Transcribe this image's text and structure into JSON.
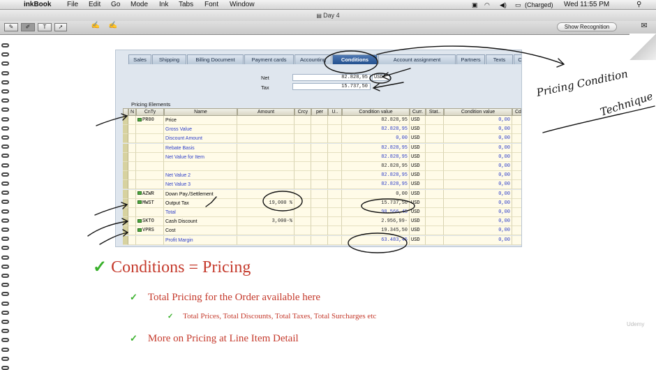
{
  "menubar": {
    "app": "inkBook",
    "items": [
      "File",
      "Edit",
      "Go",
      "Mode",
      "Ink",
      "Tabs",
      "Font",
      "Window"
    ],
    "battery": "(Charged)",
    "clock": "Wed 11:55 PM"
  },
  "window": {
    "title": "Day 4"
  },
  "toolbar": {
    "show_recognition": "Show Recognition"
  },
  "sap": {
    "tabs": [
      "Sales",
      "Shipping",
      "Billing Document",
      "Payment cards",
      "Accounting",
      "Conditions",
      "Account assignment",
      "Partners",
      "Texts",
      "Order"
    ],
    "active_tab": "Conditions",
    "net_label": "Net",
    "net_value": "82.828,95",
    "net_currency": "USD",
    "tax_label": "Tax",
    "tax_value": "15.737,50",
    "pricing_elements_title": "Pricing Elements",
    "columns": [
      "N",
      "CnTy",
      "Name",
      "Amount",
      "Crcy",
      "per",
      "U..",
      "Condition value",
      "Curr.",
      "Stat..",
      "Condition value",
      "CdC"
    ],
    "rows": [
      {
        "cnty": "PR00",
        "name": "Price",
        "amount": "",
        "cond": "82.828,95",
        "curr": "USD",
        "cv2": "0,00",
        "blue": false,
        "icon": true
      },
      {
        "cnty": "",
        "name": "Gross Value",
        "amount": "",
        "cond": "82.828,95",
        "curr": "USD",
        "cv2": "0,00",
        "blue": true,
        "icon": false
      },
      {
        "cnty": "",
        "name": "Discount Amount",
        "amount": "",
        "cond": "0,00",
        "curr": "USD",
        "cv2": "0,00",
        "blue": true,
        "icon": false
      },
      {
        "cnty": "",
        "name": "Rebate Basis",
        "amount": "",
        "cond": "82.828,95",
        "curr": "USD",
        "cv2": "0,00",
        "blue": true,
        "icon": false
      },
      {
        "cnty": "",
        "name": "Net Value for Item",
        "amount": "",
        "cond": "82.828,95",
        "curr": "USD",
        "cv2": "0,00",
        "blue": true,
        "icon": false
      },
      {
        "cnty": "",
        "name": "",
        "amount": "",
        "cond": "82.828,95",
        "curr": "USD",
        "cv2": "0,00",
        "blue": false,
        "icon": false
      },
      {
        "cnty": "",
        "name": "Net Value 2",
        "amount": "",
        "cond": "82.828,95",
        "curr": "USD",
        "cv2": "0,00",
        "blue": true,
        "icon": false
      },
      {
        "cnty": "",
        "name": "Net Value 3",
        "amount": "",
        "cond": "82.828,95",
        "curr": "USD",
        "cv2": "0,00",
        "blue": true,
        "icon": false
      },
      {
        "cnty": "AZWR",
        "name": "Down Pay./Settlement",
        "amount": "",
        "cond": "0,00",
        "curr": "USD",
        "cv2": "0,00",
        "blue": false,
        "icon": true
      },
      {
        "cnty": "MWST",
        "name": "Output Tax",
        "amount": "19,000 %",
        "cond": "15.737,50",
        "curr": "USD",
        "cv2": "0,00",
        "blue": false,
        "icon": true
      },
      {
        "cnty": "",
        "name": "Total",
        "amount": "",
        "cond": "98.566,45",
        "curr": "USD",
        "cv2": "0,00",
        "blue": true,
        "icon": false
      },
      {
        "cnty": "SKTO",
        "name": "Cash Discount",
        "amount": "3,000-%",
        "cond": "2.956,99-",
        "curr": "USD",
        "cv2": "0,00",
        "blue": false,
        "icon": true
      },
      {
        "cnty": "VPRS",
        "name": "Cost",
        "amount": "",
        "cond": "19.345,50",
        "curr": "USD",
        "cv2": "0,00",
        "blue": false,
        "icon": true
      },
      {
        "cnty": "",
        "name": "Profit Margin",
        "amount": "",
        "cond": "63.483,45",
        "curr": "USD",
        "cv2": "0,00",
        "blue": true,
        "icon": false
      }
    ]
  },
  "slide": {
    "headline": "Conditions = Pricing",
    "bullet1": "Total Pricing for the Order available here",
    "bullet2": "Total Prices, Total Discounts, Total Taxes, Total Surcharges etc",
    "bullet3": "More on Pricing at Line Item Detail",
    "check": "✓",
    "watermark": "Udemy"
  },
  "handwriting": {
    "line1": "Pricing Condition",
    "line2": "Technique"
  },
  "colors": {
    "accent_red": "#c53a2c",
    "check_green": "#38b02a",
    "sap_tab_active": "#23508e"
  }
}
